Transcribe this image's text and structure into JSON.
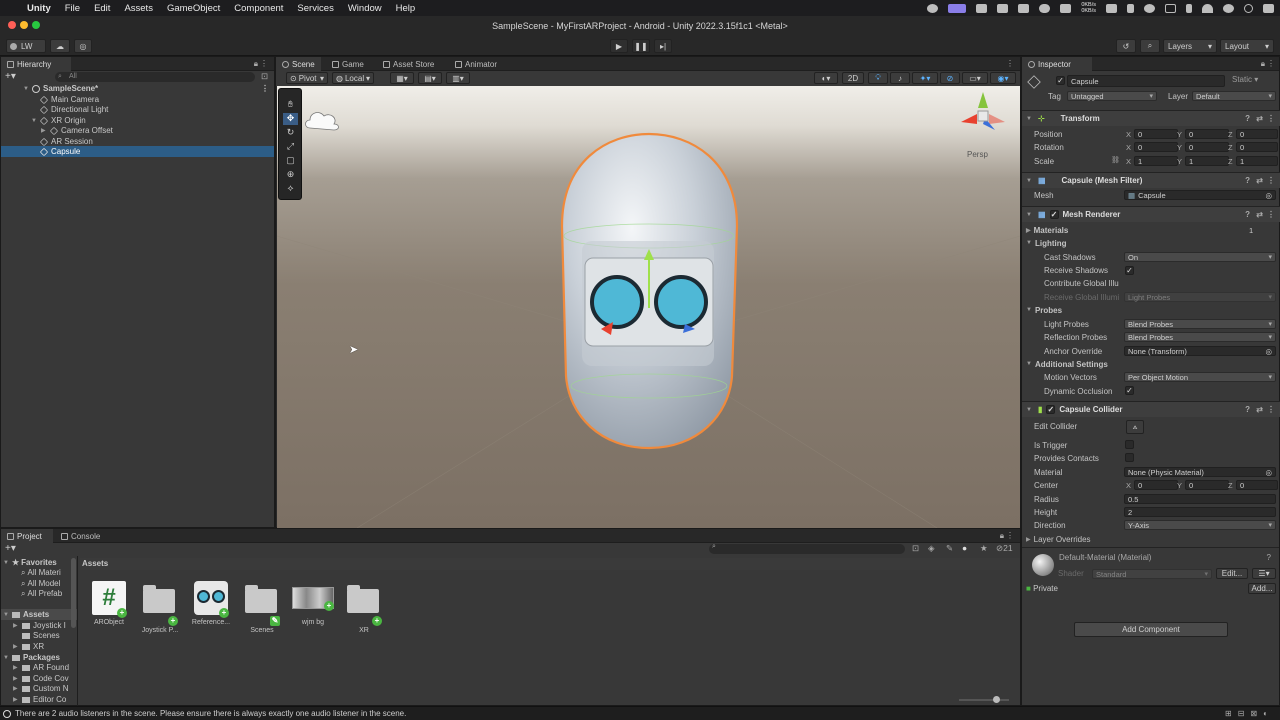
{
  "menubar": {
    "app": "Unity",
    "items": [
      "File",
      "Edit",
      "Assets",
      "GameObject",
      "Component",
      "Services",
      "Window",
      "Help"
    ],
    "net_up": "0KB/s",
    "net_down": "0KB/s"
  },
  "window": {
    "title": "SampleScene - MyFirstARProject - Android - Unity 2022.3.15f1c1 <Metal>"
  },
  "toolbar": {
    "account": "LW",
    "layers_label": "Layers",
    "layout_label": "Layout"
  },
  "hierarchy": {
    "tab": "Hierarchy",
    "search_placeholder": "All",
    "items": [
      {
        "label": "SampleScene*"
      },
      {
        "label": "Main Camera"
      },
      {
        "label": "Directional Light"
      },
      {
        "label": "XR Origin"
      },
      {
        "label": "Camera Offset"
      },
      {
        "label": "AR Session"
      },
      {
        "label": "Capsule"
      }
    ]
  },
  "scene": {
    "tabs": [
      "Scene",
      "Game",
      "Asset Store",
      "Animator"
    ],
    "pivot": "Pivot",
    "local": "Local",
    "mode_2d": "2D",
    "persp": "Persp"
  },
  "inspector": {
    "tab": "Inspector",
    "object_name": "Capsule",
    "static_label": "Static",
    "tag_label": "Tag",
    "tag_value": "Untagged",
    "layer_label": "Layer",
    "layer_value": "Default",
    "transform": {
      "title": "Transform",
      "position_label": "Position",
      "rotation_label": "Rotation",
      "scale_label": "Scale",
      "position": [
        "0",
        "0",
        "0"
      ],
      "rotation": [
        "0",
        "0",
        "0"
      ],
      "scale": [
        "1",
        "1",
        "1"
      ]
    },
    "mesh_filter": {
      "title": "Capsule (Mesh Filter)",
      "mesh_label": "Mesh",
      "mesh_value": "Capsule"
    },
    "mesh_renderer": {
      "title": "Mesh Renderer",
      "materials_label": "Materials",
      "materials_count": "1",
      "lighting_label": "Lighting",
      "cast_shadows_label": "Cast Shadows",
      "cast_shadows_value": "On",
      "receive_shadows_label": "Receive Shadows",
      "contribute_gi_label": "Contribute Global Illu",
      "receive_gi_label": "Receive Global Illumi",
      "receive_gi_value": "Light Probes",
      "probes_label": "Probes",
      "light_probes_label": "Light Probes",
      "light_probes_value": "Blend Probes",
      "reflection_probes_label": "Reflection Probes",
      "reflection_probes_value": "Blend Probes",
      "anchor_override_label": "Anchor Override",
      "anchor_override_value": "None (Transform)",
      "additional_settings_label": "Additional Settings",
      "motion_vectors_label": "Motion Vectors",
      "motion_vectors_value": "Per Object Motion",
      "dynamic_occlusion_label": "Dynamic Occlusion"
    },
    "capsule_collider": {
      "title": "Capsule Collider",
      "edit_collider_label": "Edit Collider",
      "is_trigger_label": "Is Trigger",
      "provides_contacts_label": "Provides Contacts",
      "material_label": "Material",
      "material_value": "None (Physic Material)",
      "center_label": "Center",
      "center": [
        "0",
        "0",
        "0"
      ],
      "radius_label": "Radius",
      "radius": "0.5",
      "height_label": "Height",
      "height": "2",
      "direction_label": "Direction",
      "direction_value": "Y-Axis",
      "layer_overrides_label": "Layer Overrides"
    },
    "material": {
      "title": "Default-Material (Material)",
      "shader_label": "Shader",
      "shader_value": "Standard",
      "edit_label": "Edit...",
      "private_label": "Private",
      "add_label": "Add..."
    },
    "add_component_label": "Add Component"
  },
  "project": {
    "tabs": [
      "Project",
      "Console"
    ],
    "badge_count": "21",
    "favorites_label": "Favorites",
    "favorites": [
      "All Materi",
      "All Model",
      "All Prefab"
    ],
    "assets_label": "Assets",
    "asset_folders": [
      "Joystick I",
      "Scenes",
      "XR"
    ],
    "packages_label": "Packages",
    "packages": [
      "AR Found",
      "Code Cov",
      "Custom N",
      "Editor Co"
    ],
    "breadcrumb": "Assets",
    "grid": [
      {
        "label": "ARObject",
        "icon": "script-icon"
      },
      {
        "label": "Joystick P...",
        "icon": "folder-icon"
      },
      {
        "label": "Reference...",
        "icon": "reference-image-icon"
      },
      {
        "label": "Scenes",
        "icon": "folder-icon"
      },
      {
        "label": "wjm bg",
        "icon": "image-thumbnail-icon"
      },
      {
        "label": "XR",
        "icon": "folder-icon"
      }
    ]
  },
  "status": {
    "message": "There are 2 audio listeners in the scene. Please ensure there is always exactly one audio listener in the scene."
  },
  "colors": {
    "selection": "#2c5d87",
    "accent": "#4ab641",
    "outline": "#f08a3c"
  }
}
